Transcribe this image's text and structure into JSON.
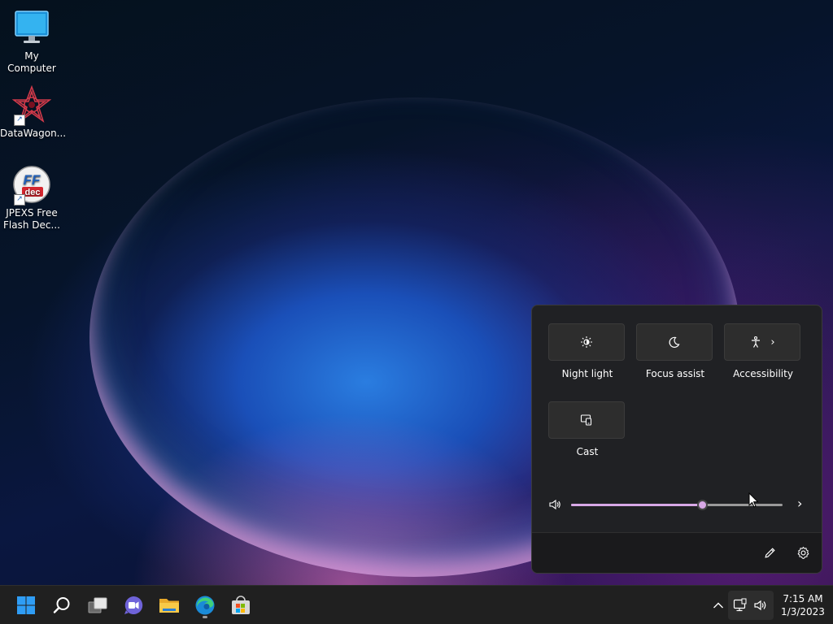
{
  "desktop": {
    "icons": [
      {
        "label": "My Computer",
        "icon": "monitor-icon"
      },
      {
        "label": "DataWagon...",
        "icon": "datawagon-app-icon"
      },
      {
        "label_line1": "JPEXS Free",
        "label_line2": "Flash Dec...",
        "icon": "ffdec-app-icon",
        "badge_line1": "FF",
        "badge_line2": "dec"
      }
    ]
  },
  "quick_settings": {
    "tiles": [
      {
        "label": "Night light",
        "icon": "brightness-icon"
      },
      {
        "label": "Focus assist",
        "icon": "moon-icon"
      },
      {
        "label": "Accessibility",
        "icon": "accessibility-icon"
      },
      {
        "label": "Cast",
        "icon": "cast-icon"
      }
    ],
    "volume": {
      "level_percent": 62,
      "icon": "speaker-icon"
    },
    "footer": {
      "edit_icon": "pencil-icon",
      "settings_icon": "gear-icon"
    }
  },
  "taskbar": {
    "apps": [
      {
        "name": "Start",
        "icon": "windows-start-icon"
      },
      {
        "name": "Search",
        "icon": "search-icon"
      },
      {
        "name": "Task View",
        "icon": "task-view-icon"
      },
      {
        "name": "Chat",
        "icon": "chat-icon"
      },
      {
        "name": "File Explorer",
        "icon": "folder-icon"
      },
      {
        "name": "Microsoft Edge",
        "icon": "edge-icon"
      },
      {
        "name": "Microsoft Store",
        "icon": "store-icon"
      }
    ],
    "clock": {
      "time": "7:15 AM",
      "date": "1/3/2023"
    }
  },
  "colors": {
    "accent": "#d8a8e6",
    "flyout_bg": "#202124",
    "taskbar_bg": "#202020"
  }
}
